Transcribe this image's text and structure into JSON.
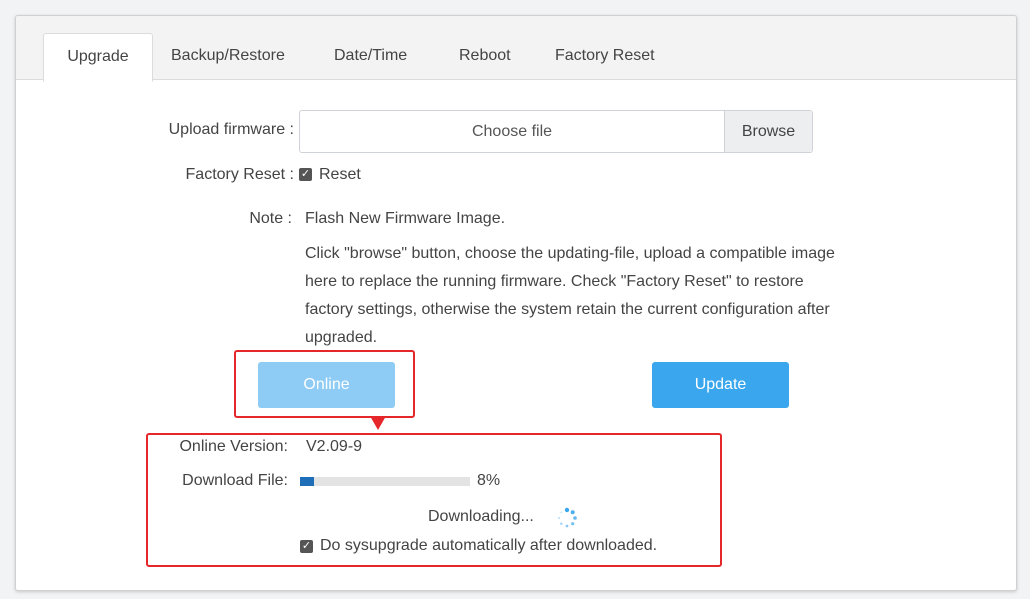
{
  "tabs": [
    "Upgrade",
    "Backup/Restore",
    "Date/Time",
    "Reboot",
    "Factory Reset"
  ],
  "upload": {
    "label": "Upload firmware :",
    "placeholder": "Choose file",
    "browse": "Browse"
  },
  "factory_reset": {
    "label": "Factory Reset :",
    "checkbox_label": "Reset",
    "checked": true
  },
  "note": {
    "label": "Note :",
    "title": "Flash New Firmware Image.",
    "body": "Click \"browse\" button, choose the updating-file, upload a compatible image here to replace the running firmware. Check \"Factory Reset\" to restore factory settings, otherwise the system retain the current configuration after upgraded."
  },
  "buttons": {
    "online": "Online",
    "update": "Update"
  },
  "online": {
    "version_label": "Online Version:",
    "version": "V2.09-9",
    "download_label": "Download File:",
    "progress": 0.08,
    "progress_text": "8%",
    "status": "Downloading...",
    "auto_label": "Do sysupgrade automatically after downloaded.",
    "auto_checked": true
  },
  "colors": {
    "primary": "#3aa6ee",
    "primary_light": "#8ecbf5",
    "progress": "#1f6fb8",
    "highlight": "#e5262b"
  }
}
